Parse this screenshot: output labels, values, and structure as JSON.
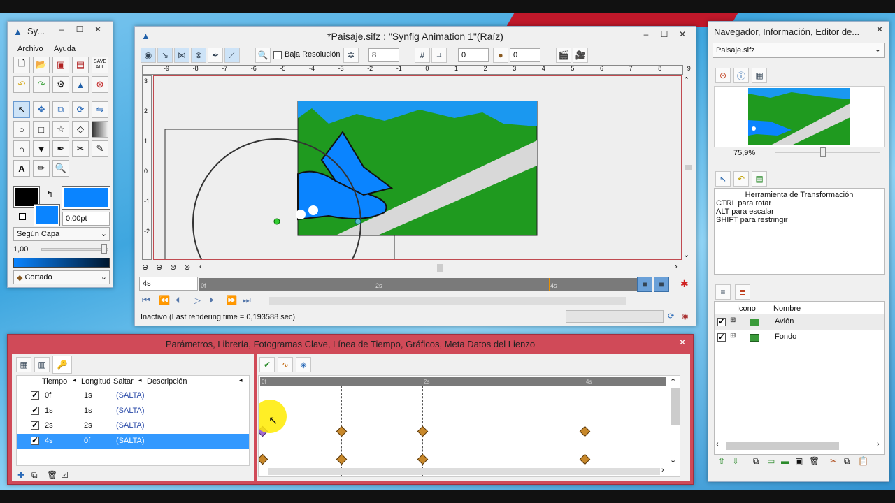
{
  "toolbox": {
    "title": "Sy...",
    "menu": [
      "Archivo",
      "Ayuda"
    ],
    "width_value": "0,00pt",
    "blend": "Según Capa",
    "opacity": "1,00",
    "outline": "Cortado",
    "save_all": "SAVE ALL"
  },
  "canvas": {
    "title": "*Paisaje.sifz : \"Synfig Animation 1\"(Raíz)",
    "low_res": "Baja Resolución",
    "value1": "8",
    "value2": "0",
    "value3": "0",
    "ruler_ticks": [
      "-9",
      "-8",
      "-7",
      "-6",
      "-5",
      "-4",
      "-3",
      "-2",
      "-1",
      "0",
      "1",
      "2",
      "3",
      "4",
      "5",
      "6",
      "7",
      "8",
      "9"
    ],
    "vruler_ticks": [
      "3",
      "2",
      "1",
      "0",
      "-1",
      "-2"
    ],
    "time_field": "4s",
    "time_marks": [
      "0f",
      "2s",
      "4s"
    ],
    "status": "Inactivo (Last rendering time = 0,193588 sec)"
  },
  "navigator": {
    "title": "Navegador, Información, Editor de...",
    "file": "Paisaje.sifz",
    "zoom": "75,9%",
    "tool_title": "Herramienta de Transformación",
    "hints": [
      "CTRL para rotar",
      "ALT para escalar",
      "SHIFT para restringir"
    ],
    "layers_header": {
      "icon": "Icono",
      "name": "Nombre"
    },
    "layers": [
      {
        "name": "Avión"
      },
      {
        "name": "Fondo"
      }
    ]
  },
  "params": {
    "title": "Parámetros, Librería, Fotogramas Clave, Línea de Tiempo, Gráficos, Meta Datos del Lienzo",
    "columns": [
      "Tiempo",
      "Longitud",
      "Saltar",
      "Descripción"
    ],
    "rows": [
      {
        "time": "0f",
        "length": "1s",
        "jump": "(SALTA)"
      },
      {
        "time": "1s",
        "length": "1s",
        "jump": "(SALTA)"
      },
      {
        "time": "2s",
        "length": "2s",
        "jump": "(SALTA)"
      },
      {
        "time": "4s",
        "length": "0f",
        "jump": "(SALTA)"
      }
    ],
    "timeline_marks": [
      "0f",
      "2s",
      "4s"
    ]
  },
  "colors": {
    "outline": "#000000",
    "fill": "#0a84ff",
    "accent": "#d04a58"
  }
}
